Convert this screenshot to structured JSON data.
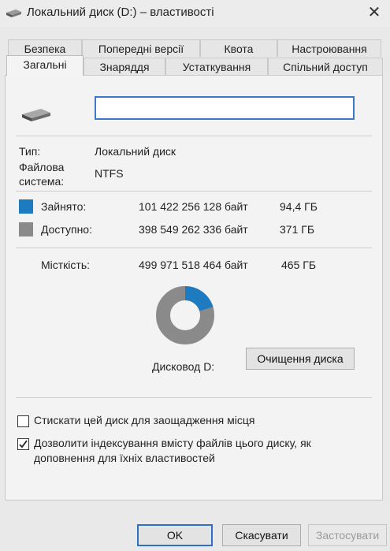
{
  "window": {
    "title": "Локальний диск (D:) – властивості",
    "close_glyph": "✕",
    "icon": "drive-icon"
  },
  "tabs": {
    "row1": [
      "Безпека",
      "Попередні версії",
      "Квота",
      "Настроювання"
    ],
    "row2": [
      "Загальні",
      "Знаряддя",
      "Устаткування",
      "Спільний доступ"
    ],
    "active": "Загальні"
  },
  "general": {
    "name_value": "",
    "type_label": "Тип:",
    "type_value": "Локальний диск",
    "fs_label_line1": "Файлова",
    "fs_label_line2": "система:",
    "fs_value": "NTFS",
    "used_label": "Зайнято:",
    "used_bytes": "101 422 256 128 байт",
    "used_size": "94,4 ГБ",
    "free_label": "Доступно:",
    "free_bytes": "398 549 262 336 байт",
    "free_size": "371 ГБ",
    "capacity_label": "Місткість:",
    "capacity_bytes": "499 971 518 464 байт",
    "capacity_size": "465 ГБ",
    "used_fraction": 0.203,
    "drive_label": "Дисковод D:",
    "cleanup_button": "Очищення диска",
    "compress_label": "Стискати цей диск для заощадження місця",
    "compress_checked": false,
    "index_label_line1": "Дозволити індексування вмісту файлів цього диску, як",
    "index_label_line2": "доповнення для їхніх властивостей",
    "index_checked": true
  },
  "colors": {
    "used": "#1f7bbf",
    "free": "#8a8a8a",
    "accent": "#2f6fc4"
  },
  "buttons": {
    "ok": "OK",
    "cancel": "Скасувати",
    "apply": "Застосувати"
  }
}
